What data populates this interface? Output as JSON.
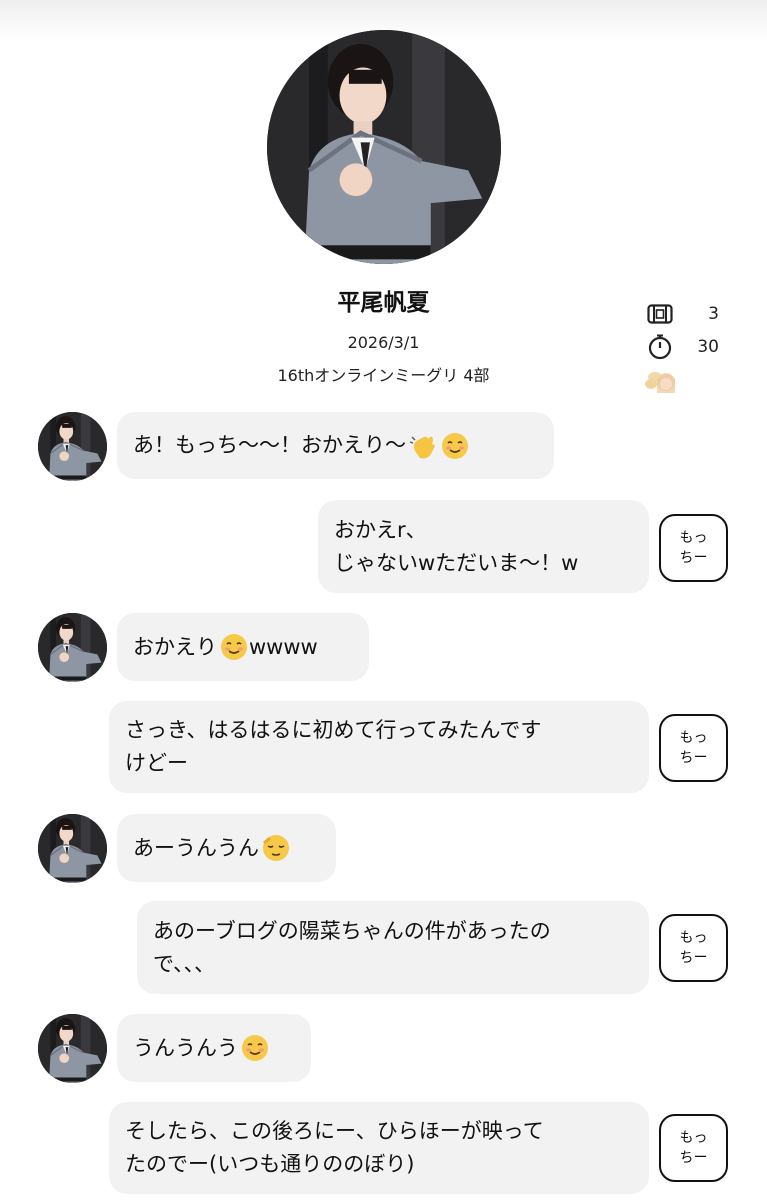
{
  "profile": {
    "name": "平尾帆夏",
    "date": "2026/3/1",
    "event": "16thオンラインミーグリ 4部"
  },
  "stats": {
    "tickets": "3",
    "seconds": "30",
    "ticket_icon": "ticket-icon",
    "timer_icon": "stopwatch-icon",
    "badge_icon": "angel-badge-emoji"
  },
  "messages": [
    {
      "from": "member",
      "text": "あ！もっち〜〜！おかえり〜",
      "emoji": [
        "waving-hand",
        "smiling-face"
      ]
    },
    {
      "from": "fan",
      "text": "おかえr、\nじゃないwただいま〜！w",
      "sender": "もっ\nちー"
    },
    {
      "from": "member",
      "text": "おかえり",
      "emoji_mid": "smiling-face",
      "text_after": "wwww"
    },
    {
      "from": "fan",
      "text": "さっき、はるはるに初めて行ってみたんです\nけどー",
      "sender": "もっ\nちー"
    },
    {
      "from": "member",
      "text": "あーうんうん",
      "emoji": [
        "relieved-face"
      ]
    },
    {
      "from": "fan",
      "text": "あのーブログの陽菜ちゃんの件があったの\nで、、、",
      "sender": "もっ\nちー"
    },
    {
      "from": "member",
      "text": "うんうんう",
      "emoji": [
        "smiling-face"
      ]
    },
    {
      "from": "fan",
      "text": "そしたら、この後ろにー、ひらほーが映って\nたのでー(いつも通りののぼり)",
      "sender": "もっ\nちー"
    }
  ]
}
